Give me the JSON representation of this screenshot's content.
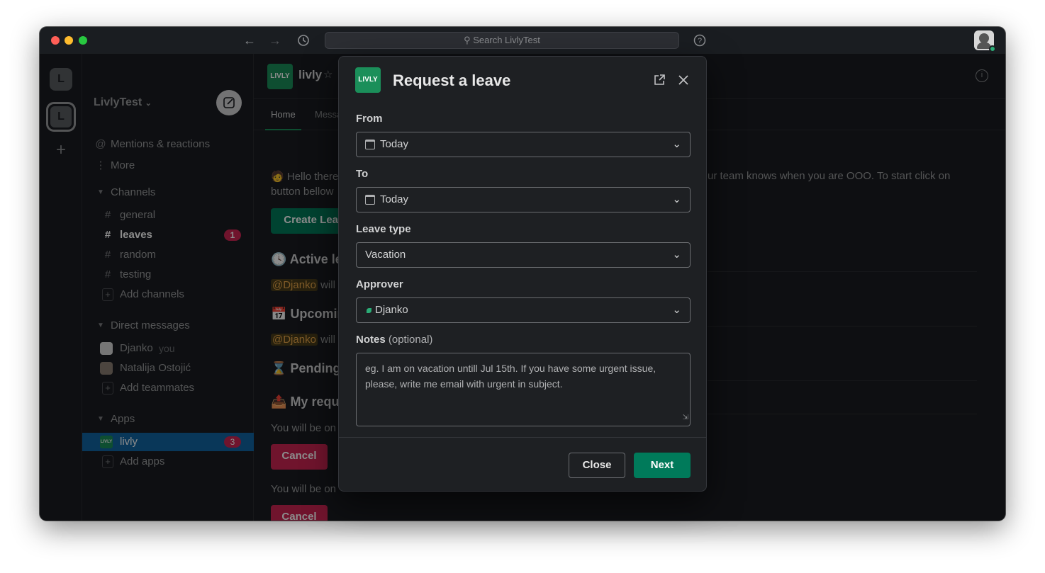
{
  "window": {
    "search_placeholder": "Search LivlyTest",
    "traffic_lights": [
      "#ff5f57",
      "#febc2e",
      "#28c840"
    ]
  },
  "rail": {
    "workspaces": [
      "L",
      "L"
    ],
    "add_symbol": "+"
  },
  "sidebar": {
    "workspace_name": "LivlyTest",
    "mentions": "Mentions & reactions",
    "more": "More",
    "channels_header": "Channels",
    "channels": [
      {
        "name": "general",
        "bold": false,
        "badge": ""
      },
      {
        "name": "leaves",
        "bold": true,
        "badge": "1"
      },
      {
        "name": "random",
        "bold": false,
        "badge": ""
      },
      {
        "name": "testing",
        "bold": false,
        "badge": ""
      }
    ],
    "add_channels": "Add channels",
    "dm_header": "Direct messages",
    "dms": [
      {
        "name": "Djanko",
        "suffix": "you"
      },
      {
        "name": "Natalija Ostojić",
        "suffix": ""
      }
    ],
    "add_teammates": "Add teammates",
    "apps_header": "Apps",
    "app": {
      "name": "livly",
      "badge": "3"
    },
    "add_apps": "Add apps"
  },
  "main": {
    "app_name": "livly",
    "tabs": [
      "Home",
      "Messa"
    ],
    "intro_left": "Hello there",
    "intro_line2": "button bellow",
    "intro_right": "ur team knows when you are OOO. To start click on",
    "create_button": "Create Leave",
    "active_title": "Active le",
    "mention1": "@Djanko",
    "will1": "will l",
    "upcoming_title": "Upcomin",
    "mention2": "@Djanko",
    "will2": "will l",
    "pending_title": "Pending",
    "myreq_title": "My reque",
    "you_will1": "You will be on",
    "cancel1": "Cancel",
    "you_will2": "You will be on",
    "cancel2": "Cancel"
  },
  "modal": {
    "logo_text": "LIVLY",
    "title": "Request a leave",
    "from_label": "From",
    "from_value": "Today",
    "to_label": "To",
    "to_value": "Today",
    "leave_type_label": "Leave type",
    "leave_type_value": "Vacation",
    "approver_label": "Approver",
    "approver_value": "Djanko",
    "notes_label": "Notes",
    "notes_optional": "(optional)",
    "notes_placeholder": "eg. I am on vacation untill Jul 15th. If you have some urgent issue, please, write me email with urgent in subject.",
    "close_button": "Close",
    "next_button": "Next"
  },
  "colors": {
    "accent_green": "#007a5a",
    "danger_red": "#cd2553",
    "selected_blue": "#1164a3",
    "logo_green": "#1b8f5a"
  }
}
